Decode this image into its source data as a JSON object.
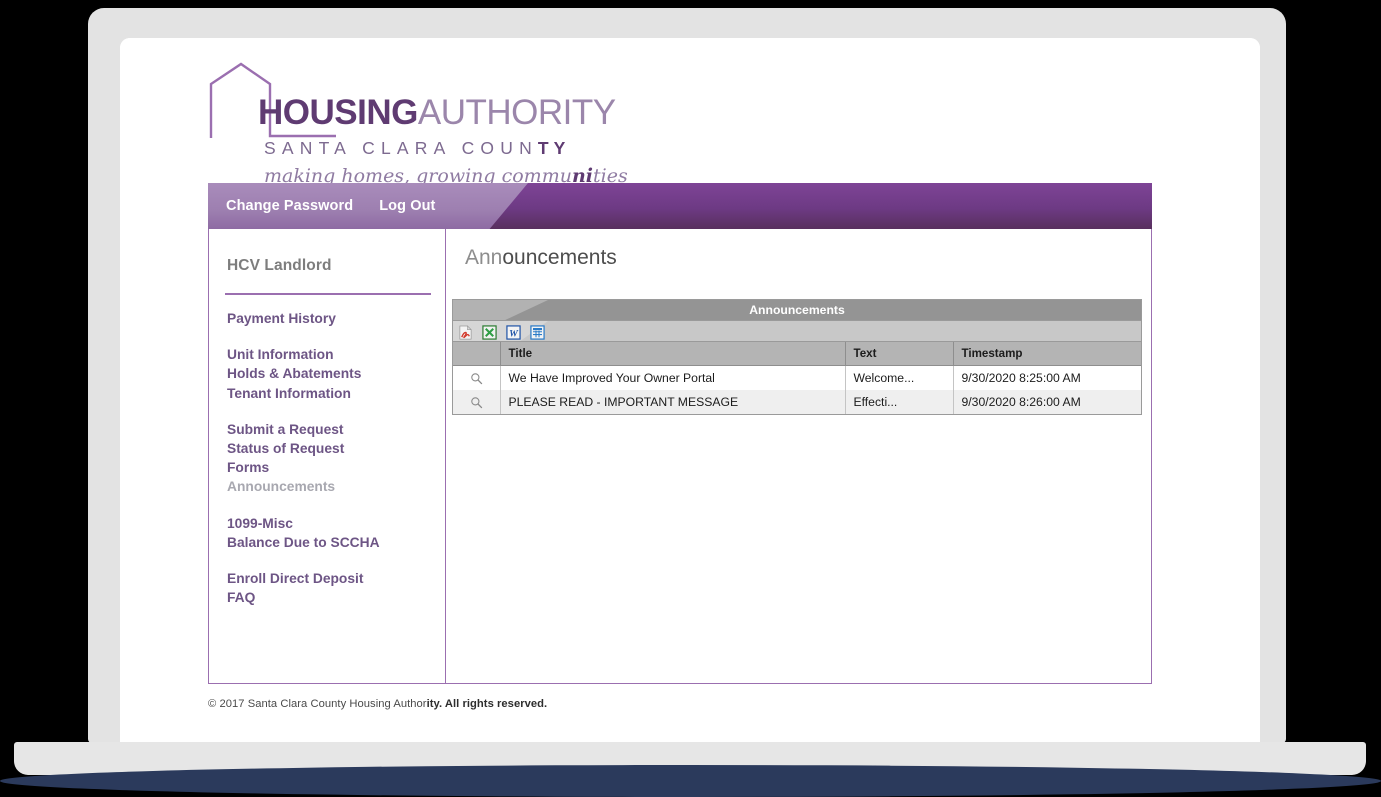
{
  "brand": {
    "logo_line1_bold": "HOUSING",
    "logo_line1_light": "AUTHORITY",
    "logo_line2": "SANTA CLARA COUN",
    "logo_line2_bold": "TY",
    "tagline_part1": "making homes, growing commu",
    "tagline_part2": "ni",
    "tagline_part3": "ties",
    "house_icon": "house-outline-icon",
    "accent_purple": "#7b3f99",
    "accent_light_purple": "#9b6fb0",
    "wordmark_dark": "#5f3b72",
    "wordmark_light": "#9b86ab"
  },
  "topnav": {
    "items": [
      {
        "label": "Change Password",
        "name": "change-password"
      },
      {
        "label": "Log Out",
        "name": "log-out"
      }
    ]
  },
  "sidebar": {
    "title": "HCV Landlord",
    "groups": [
      {
        "items": [
          {
            "label": "Payment History",
            "name": "payment-history",
            "current": false
          }
        ]
      },
      {
        "items": [
          {
            "label": "Unit Information",
            "name": "unit-information",
            "current": false
          },
          {
            "label": "Holds & Abatements",
            "name": "holds-abatements",
            "current": false
          },
          {
            "label": "Tenant Information",
            "name": "tenant-information",
            "current": false
          }
        ]
      },
      {
        "items": [
          {
            "label": "Submit a Request",
            "name": "submit-a-request",
            "current": false
          },
          {
            "label": "Status of Request",
            "name": "status-of-request",
            "current": false
          },
          {
            "label": "Forms",
            "name": "forms",
            "current": false
          },
          {
            "label": "Announcements",
            "name": "announcements",
            "current": true
          }
        ]
      },
      {
        "items": [
          {
            "label": "1099-Misc",
            "name": "1099-misc",
            "current": false
          },
          {
            "label": "Balance Due to SCCHA",
            "name": "balance-due-to-sccha",
            "current": false
          }
        ]
      },
      {
        "items": [
          {
            "label": "Enroll Direct Deposit",
            "name": "enroll-direct-deposit",
            "current": false
          },
          {
            "label": "FAQ",
            "name": "faq",
            "current": false
          }
        ]
      }
    ]
  },
  "main": {
    "title_fade": "Ann",
    "title_dark": "ouncements",
    "grid": {
      "caption": "Announcements",
      "export_icons": [
        {
          "name": "export-pdf-icon",
          "label": "PDF"
        },
        {
          "name": "export-excel-icon",
          "label": "Excel"
        },
        {
          "name": "export-word-icon",
          "label": "Word"
        },
        {
          "name": "export-grid-icon",
          "label": "Grid"
        }
      ],
      "columns": [
        {
          "key": "action",
          "label": ""
        },
        {
          "key": "title",
          "label": "Title"
        },
        {
          "key": "text",
          "label": "Text"
        },
        {
          "key": "timestamp",
          "label": "Timestamp"
        }
      ],
      "rows": [
        {
          "action_icon": "search-icon",
          "title": "We Have Improved Your Owner Portal",
          "text": "Welcome...",
          "timestamp": "9/30/2020 8:25:00 AM"
        },
        {
          "action_icon": "search-icon",
          "title": "PLEASE READ - IMPORTANT MESSAGE",
          "text": "Effecti...",
          "timestamp": "9/30/2020 8:26:00 AM"
        }
      ]
    }
  },
  "footer": {
    "text_part1": "© 2017 Santa Clara County Housing Author",
    "text_part2": "ity. All rights reserved."
  }
}
